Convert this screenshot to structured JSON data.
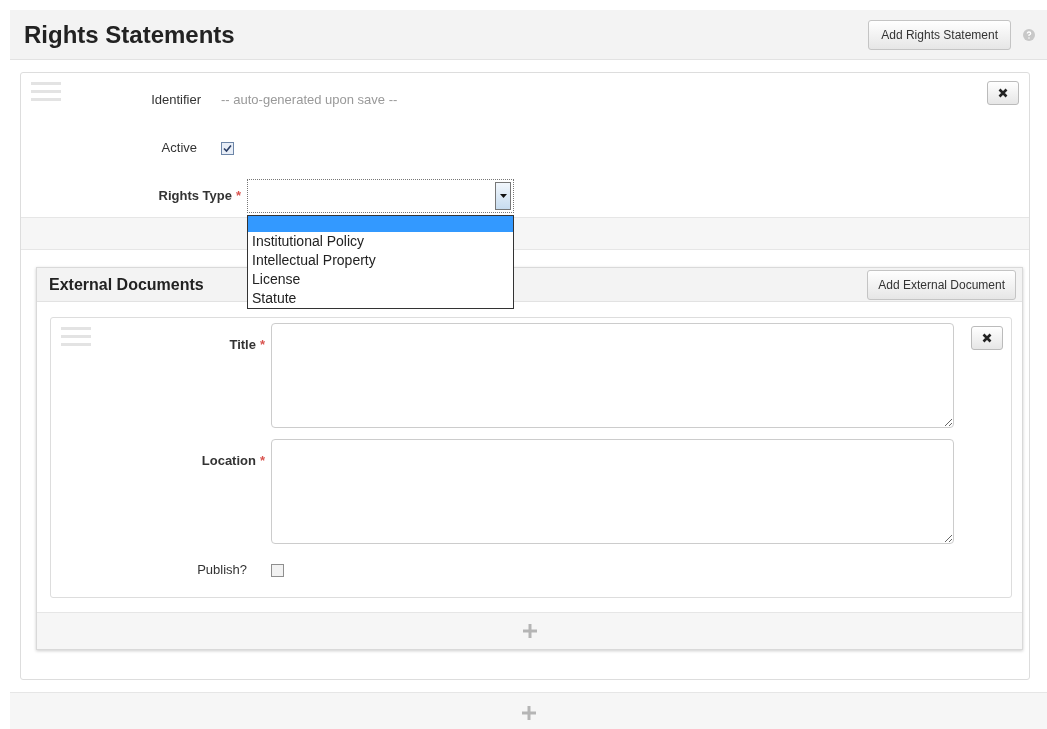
{
  "header": {
    "title": "Rights Statements",
    "add_button": "Add Rights Statement"
  },
  "statement": {
    "identifier": {
      "label": "Identifier",
      "value": "-- auto-generated upon save --"
    },
    "active": {
      "label": "Active",
      "checked": true
    },
    "rights_type": {
      "label": "Rights Type",
      "required_mark": "*",
      "dropdown_open": true,
      "blank_option_highlighted": true,
      "options": [
        {
          "label": "Institutional Policy",
          "selected": false
        },
        {
          "label": "Intellectual Property",
          "selected": false
        },
        {
          "label": "License",
          "selected": false
        },
        {
          "label": "Statute",
          "selected": false
        }
      ]
    }
  },
  "external_documents": {
    "title": "External Documents",
    "add_button": "Add External Document",
    "fields": [
      {
        "label": "Title",
        "required_mark": "*"
      },
      {
        "label": "Location",
        "required_mark": "*"
      }
    ],
    "publish": {
      "label": "Publish?",
      "checked": false
    }
  }
}
